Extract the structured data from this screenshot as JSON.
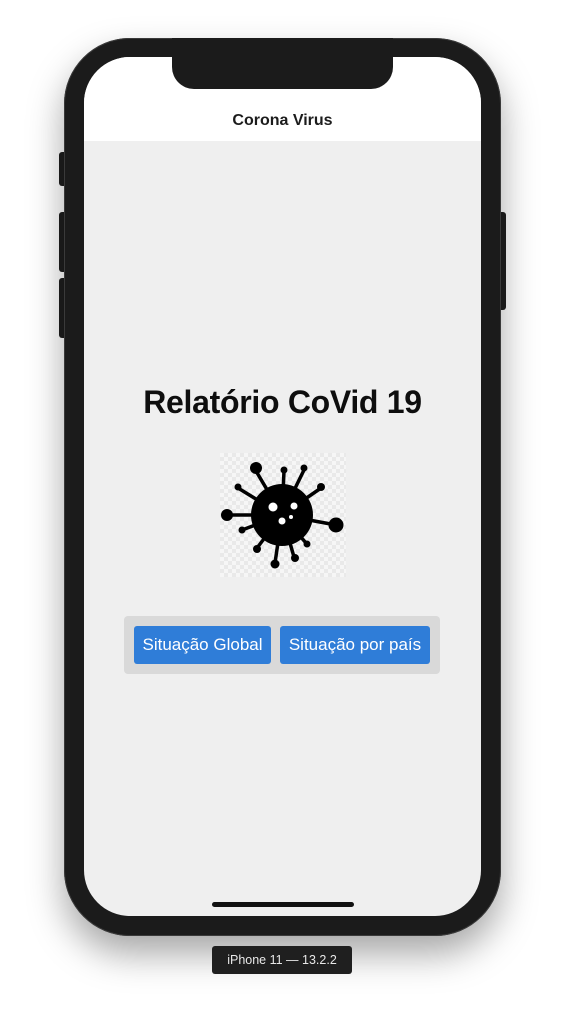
{
  "app": {
    "nav_title": "Corona Virus",
    "heading": "Relatório CoVid 19"
  },
  "image": {
    "icon": "coronavirus-icon"
  },
  "buttons": {
    "global_label": "Situação Global",
    "country_label": "Situação por país"
  },
  "simulator": {
    "device_label": "iPhone 11 — 13.2.2"
  },
  "colors": {
    "background": "#efefef",
    "navbar": "#ffffff",
    "button": "#2f7dd8",
    "button_text": "#ffffff",
    "button_group": "#d9d9d9"
  }
}
